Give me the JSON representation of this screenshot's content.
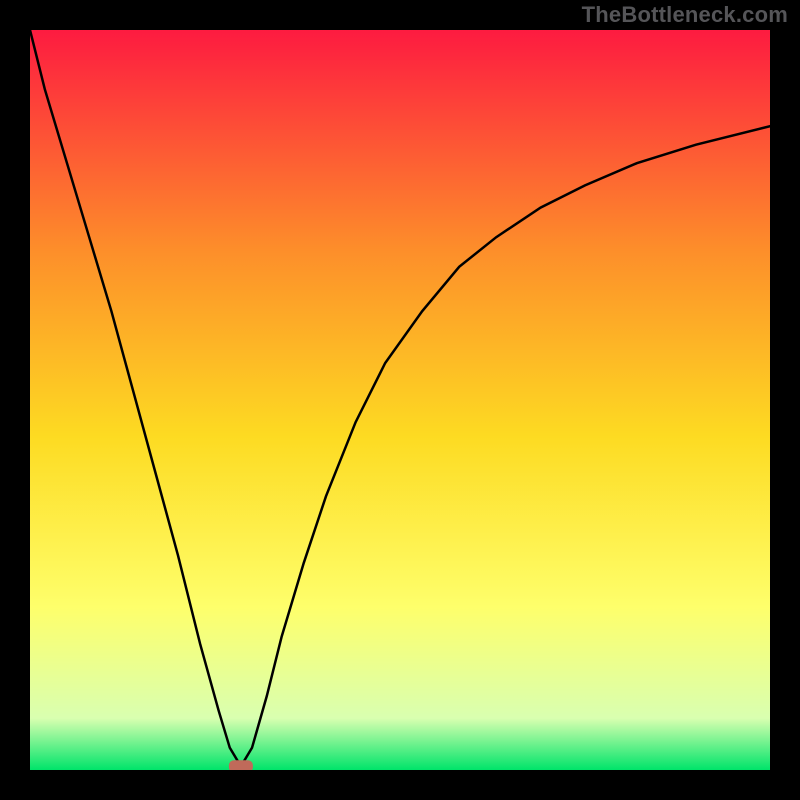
{
  "watermark": "TheBottleneck.com",
  "chart_data": {
    "type": "line",
    "title": "",
    "xlabel": "",
    "ylabel": "",
    "xlim": [
      0,
      100
    ],
    "ylim": [
      0,
      100
    ],
    "grid": false,
    "legend": false,
    "background_gradient": {
      "top": "#fd1b40",
      "mid_upper": "#fd8f2a",
      "mid": "#fddb22",
      "mid_lower": "#feff6b",
      "near_bottom": "#d9ffb0",
      "bottom": "#00e46a"
    },
    "series": [
      {
        "name": "primary-curve",
        "x": [
          0,
          2,
          5,
          8,
          11,
          14,
          17,
          20,
          23,
          25.5,
          27,
          28.5,
          30,
          32,
          34,
          37,
          40,
          44,
          48,
          53,
          58,
          63,
          69,
          75,
          82,
          90,
          100
        ],
        "y": [
          100,
          92,
          82,
          72,
          62,
          51,
          40,
          29,
          17,
          8,
          3,
          0.5,
          3,
          10,
          18,
          28,
          37,
          47,
          55,
          62,
          68,
          72,
          76,
          79,
          82,
          84.5,
          87
        ]
      }
    ],
    "annotations": [
      {
        "name": "min-marker",
        "x": 28.5,
        "y": 0.5,
        "shape": "rounded-rect",
        "color": "#c06a5a"
      }
    ]
  }
}
